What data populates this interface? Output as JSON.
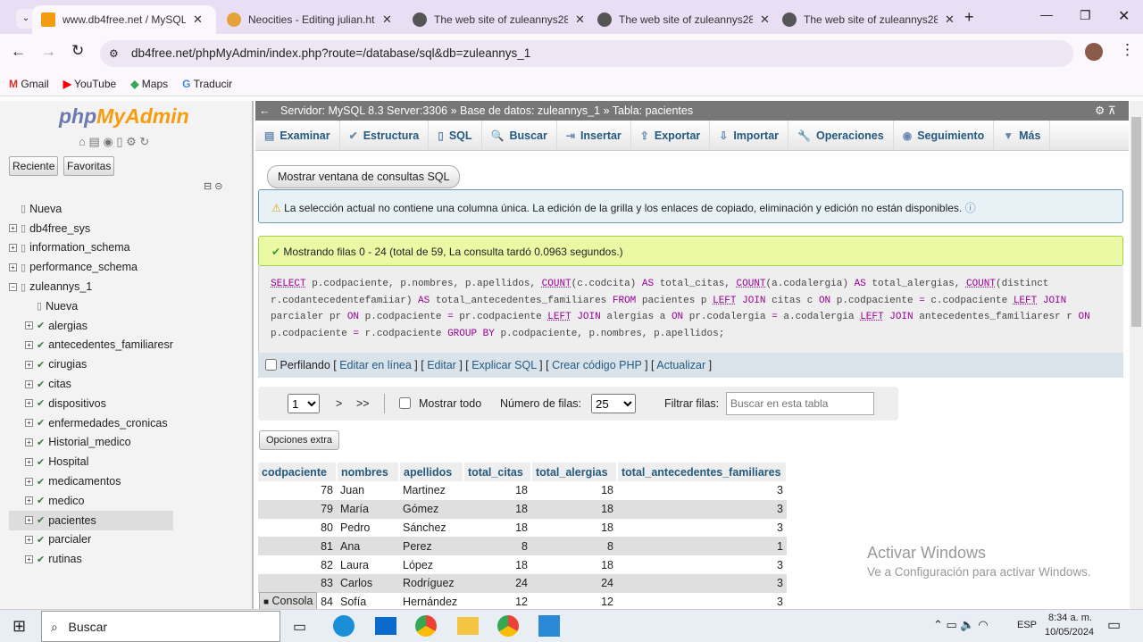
{
  "browser": {
    "tabs": [
      {
        "title": "www.db4free.net / MySQL 8.",
        "active": true
      },
      {
        "title": "Neocities - Editing julian.htm"
      },
      {
        "title": "The web site of zuleannys28"
      },
      {
        "title": "The web site of zuleannys28"
      },
      {
        "title": "The web site of zuleannys28"
      }
    ],
    "url": "db4free.net/phpMyAdmin/index.php?route=/database/sql&db=zuleannys_1",
    "bookmarks": [
      "Gmail",
      "YouTube",
      "Maps",
      "Traducir"
    ]
  },
  "sidebar": {
    "logo_php": "php",
    "logo_my": "MyAdmin",
    "recent": "Reciente",
    "favorites": "Favoritas",
    "tree": [
      {
        "label": "Nueva",
        "level": 0
      },
      {
        "label": "db4free_sys",
        "level": 0
      },
      {
        "label": "information_schema",
        "level": 0
      },
      {
        "label": "performance_schema",
        "level": 0
      },
      {
        "label": "zuleannys_1",
        "level": 0
      },
      {
        "label": "Nueva",
        "level": 1
      },
      {
        "label": "alergias",
        "level": 1
      },
      {
        "label": "antecedentes_familiaresr",
        "level": 1
      },
      {
        "label": "cirugias",
        "level": 1
      },
      {
        "label": "citas",
        "level": 1
      },
      {
        "label": "dispositivos",
        "level": 1
      },
      {
        "label": "enfermedades_cronicas",
        "level": 1
      },
      {
        "label": "Historial_medico",
        "level": 1
      },
      {
        "label": "Hospital",
        "level": 1
      },
      {
        "label": "medicamentos",
        "level": 1
      },
      {
        "label": "medico",
        "level": 1
      },
      {
        "label": "pacientes",
        "level": 1,
        "selected": true
      },
      {
        "label": "parcialer",
        "level": 1
      },
      {
        "label": "rutinas",
        "level": 1
      }
    ]
  },
  "breadcrumb": {
    "server": "Servidor: MySQL 8.3 Server:3306",
    "db": "Base de datos: zuleannys_1",
    "table": "Tabla: pacientes"
  },
  "menu": [
    "Examinar",
    "Estructura",
    "SQL",
    "Buscar",
    "Insertar",
    "Exportar",
    "Importar",
    "Operaciones",
    "Seguimiento",
    "Más"
  ],
  "show_sql_button": "Mostrar ventana de consultas SQL",
  "notice": "La selección actual no contiene una columna única. La edición de la grilla y los enlaces de copiado, eliminación y edición no están disponibles.",
  "success": "Mostrando filas 0 - 24 (total de 59, La consulta tardó 0.0963 segundos.)",
  "profiling": {
    "label": "Perfilando",
    "links": [
      "Editar en línea",
      "Editar",
      "Explicar SQL",
      "Crear código PHP",
      "Actualizar"
    ]
  },
  "nav": {
    "page": "1",
    "next": ">",
    "last": ">>",
    "show_all": "Mostrar todo",
    "rows_label": "Número de filas:",
    "rows": "25",
    "filter_label": "Filtrar filas:",
    "filter_placeholder": "Buscar en esta tabla"
  },
  "extra_options": "Opciones extra",
  "table": {
    "columns": [
      "codpaciente",
      "nombres",
      "apellidos",
      "total_citas",
      "total_alergias",
      "total_antecedentes_familiares"
    ],
    "rows": [
      [
        78,
        "Juan",
        "Martinez",
        18,
        18,
        3
      ],
      [
        79,
        "María",
        "Gómez",
        18,
        18,
        3
      ],
      [
        80,
        "Pedro",
        "Sánchez",
        18,
        18,
        3
      ],
      [
        81,
        "Ana",
        "Perez",
        8,
        8,
        1
      ],
      [
        82,
        "Laura",
        "López",
        18,
        18,
        3
      ],
      [
        83,
        "Carlos",
        "Rodríguez",
        24,
        24,
        3
      ],
      [
        84,
        "Sofía",
        "Hernández",
        12,
        12,
        3
      ]
    ]
  },
  "console": "Consola",
  "watermark": {
    "title": "Activar Windows",
    "sub": "Ve a Configuración para activar Windows."
  },
  "taskbar": {
    "search": "Buscar",
    "lang": "ESP",
    "time": "8:34 a. m.",
    "date": "10/05/2024"
  }
}
